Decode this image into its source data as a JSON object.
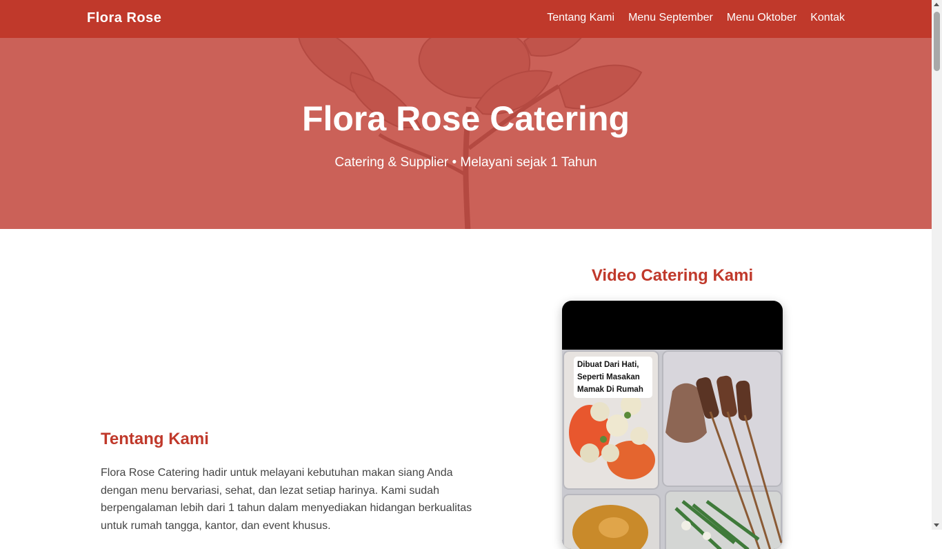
{
  "navbar": {
    "brand": "Flora Rose",
    "links": [
      {
        "label": "Tentang Kami"
      },
      {
        "label": "Menu September"
      },
      {
        "label": "Menu Oktober"
      },
      {
        "label": "Kontak"
      }
    ]
  },
  "hero": {
    "title": "Flora Rose Catering",
    "subtitle": "Catering & Supplier • Melayani sejak 1 Tahun"
  },
  "about": {
    "title": "Tentang Kami",
    "text": "Flora Rose Catering hadir untuk melayani kebutuhan makan siang Anda dengan menu bervariasi, sehat, dan lezat setiap harinya. Kami sudah berpengalaman lebih dari 1 tahun dalam menyediakan hidangan berkualitas untuk rumah tangga, kantor, dan event khusus."
  },
  "video": {
    "title": "Video Catering Kami",
    "caption_lines": [
      "Dibuat Dari Hati,",
      "Seperti Masakan",
      "Mamak Di Rumah"
    ]
  },
  "colors": {
    "brand": "#c0392b",
    "hero_bg": "#cb6158"
  }
}
